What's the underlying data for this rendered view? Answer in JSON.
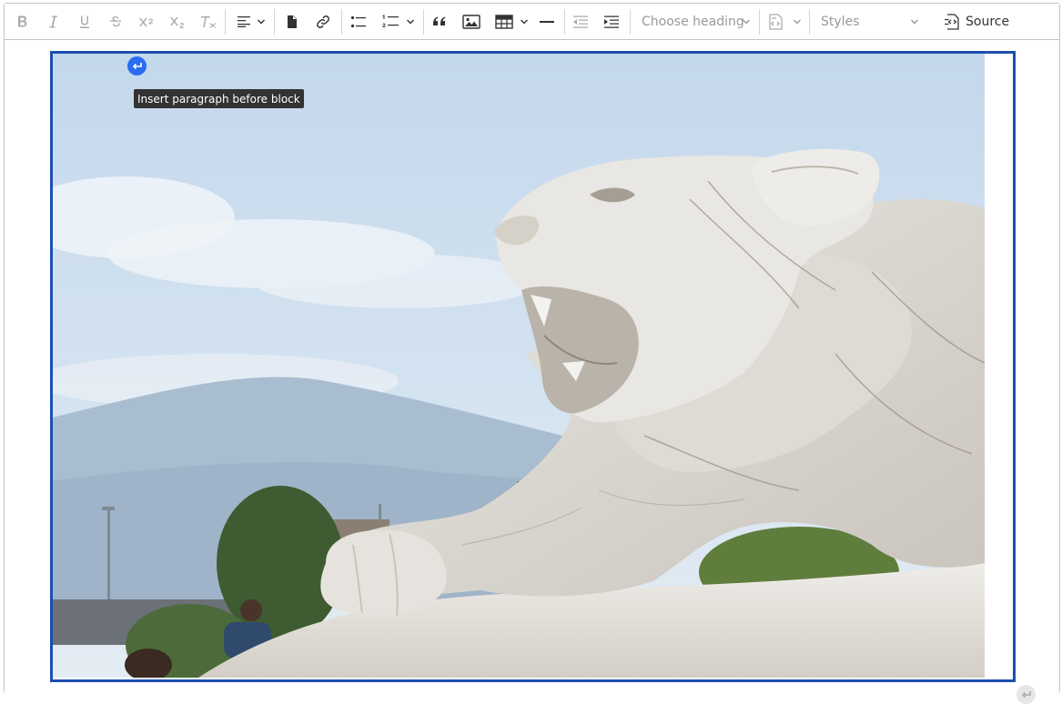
{
  "toolbar": {
    "heading_placeholder": "Choose heading",
    "styles_placeholder": "Styles",
    "source_label": "Source",
    "buttons": [
      {
        "name": "bold",
        "icon": "bold-icon",
        "enabled": false
      },
      {
        "name": "italic",
        "icon": "italic-icon",
        "enabled": false
      },
      {
        "name": "underline",
        "icon": "underline-icon",
        "enabled": false
      },
      {
        "name": "strikethrough",
        "icon": "strikethrough-icon",
        "enabled": false
      },
      {
        "name": "superscript",
        "icon": "superscript-icon",
        "enabled": false
      },
      {
        "name": "subscript",
        "icon": "subscript-icon",
        "enabled": false
      },
      {
        "name": "remove-format",
        "icon": "remove-format-icon",
        "enabled": false
      },
      {
        "name": "alignment",
        "icon": "align-left-icon",
        "enabled": true
      },
      {
        "name": "insert-media",
        "icon": "document-icon",
        "enabled": true
      },
      {
        "name": "link",
        "icon": "link-icon",
        "enabled": true
      },
      {
        "name": "bulleted-list",
        "icon": "bulleted-list-icon",
        "enabled": true
      },
      {
        "name": "numbered-list",
        "icon": "numbered-list-icon",
        "enabled": true
      },
      {
        "name": "block-quote",
        "icon": "quote-icon",
        "enabled": true
      },
      {
        "name": "insert-image",
        "icon": "image-icon",
        "enabled": true
      },
      {
        "name": "insert-table",
        "icon": "table-icon",
        "enabled": true
      },
      {
        "name": "horizontal-line",
        "icon": "horizontal-line-icon",
        "enabled": true
      },
      {
        "name": "outdent",
        "icon": "outdent-icon",
        "enabled": false
      },
      {
        "name": "indent",
        "icon": "indent-icon",
        "enabled": true
      },
      {
        "name": "code-block",
        "icon": "code-block-icon",
        "enabled": false
      },
      {
        "name": "source",
        "icon": "source-icon",
        "enabled": true
      }
    ]
  },
  "widget": {
    "tooltip": "Insert paragraph before block",
    "selection_color": "#1d4fb0",
    "handle_color": "#2a6df4"
  },
  "image": {
    "subject": "white marble mountain lion statue",
    "colors": {
      "sky": "#c9dcee",
      "marble": "#e8e6e2",
      "trees": "#4d6b3a",
      "mountains": "#9fb6cc"
    }
  }
}
